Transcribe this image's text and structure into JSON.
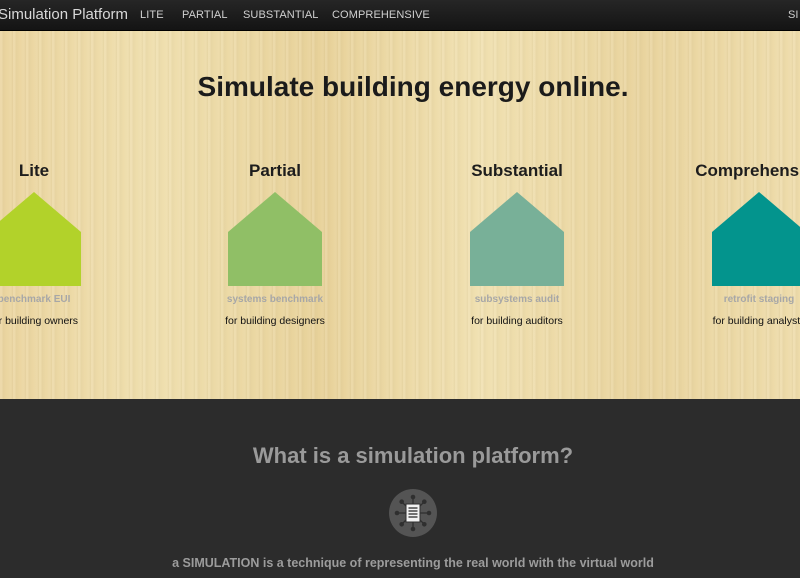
{
  "navbar": {
    "brand": "Simulation Platform",
    "links": [
      "LITE",
      "PARTIAL",
      "SUBSTANTIAL",
      "COMPREHENSIVE"
    ],
    "right_link": "SI"
  },
  "hero": {
    "title": "Simulate building energy online.",
    "tiers": [
      {
        "name": "Lite",
        "subtitle": "benchmark EUI",
        "audience": "for building owners",
        "color": "#b2d22a"
      },
      {
        "name": "Partial",
        "subtitle": "systems benchmark",
        "audience": "for building designers",
        "color": "#90bf66"
      },
      {
        "name": "Substantial",
        "subtitle": "subsystems audit",
        "audience": "for building auditors",
        "color": "#78b098"
      },
      {
        "name": "Comprehensive",
        "subtitle": "retrofit staging",
        "audience": "for building analysts",
        "color": "#03948d"
      }
    ]
  },
  "section": {
    "title": "What is a simulation platform?",
    "icon": "network-document-icon",
    "text": "a SIMULATION is a technique of representing the real world with the virtual world"
  }
}
